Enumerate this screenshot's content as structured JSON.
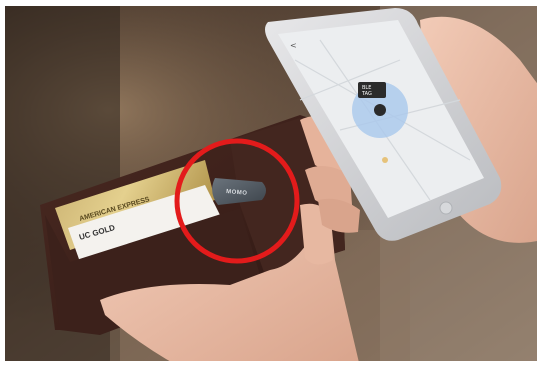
{
  "photo": {
    "subject": "Hand holding a brown leather wallet with a tracker tag, while another hand holds a smartphone showing a map app",
    "tag_text": "MOMO",
    "cards": [
      {
        "text": "AMERICAN EXPRESS"
      },
      {
        "text": "UC GOLD"
      }
    ],
    "phone_screen": {
      "back_label": "<",
      "pin_label_line1": "BLE",
      "pin_label_line2": "TAG"
    },
    "highlight_color": "#e31b1b"
  }
}
